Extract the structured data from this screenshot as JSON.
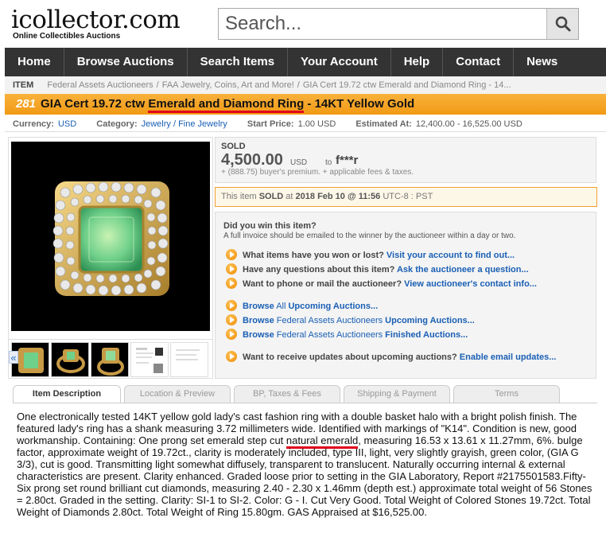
{
  "header": {
    "logo_text": "icollector.com",
    "logo_tagline": "Online Collectibles Auctions",
    "search_placeholder": "Search..."
  },
  "nav": {
    "items": [
      "Home",
      "Browse Auctions",
      "Search Items",
      "Your Account",
      "Help",
      "Contact",
      "News"
    ]
  },
  "breadcrumb": {
    "label": "ITEM",
    "items": [
      "Federal Assets Auctioneers",
      "FAA Jewelry, Coins, Art and More!",
      "GIA Cert 19.72 ctw Emerald and Diamond Ring - 14..."
    ]
  },
  "lot": {
    "number": "281",
    "title_pre": "GIA Cert 19.72 ctw ",
    "title_highlight": "Emerald and Diamond Ring",
    "title_post": " - 14KT Yellow Gold"
  },
  "info": {
    "currency_label": "Currency:",
    "currency_value": "USD",
    "category_label": "Category:",
    "category_value": "Jewelry / Fine Jewelry",
    "start_label": "Start Price:",
    "start_value": "1.00 USD",
    "est_label": "Estimated At:",
    "est_value": "12,400.00 - 16,525.00 USD"
  },
  "sold": {
    "label": "SOLD",
    "amount": "4,500.00",
    "currency": "USD",
    "to": "to",
    "buyer": "f***r",
    "fees": "+ (888.75) buyer's premium. + applicable fees & taxes."
  },
  "sold_note": {
    "pre": "This item ",
    "sold": "SOLD",
    "at": " at ",
    "date": "2018 Feb 10 @ 11:56",
    "tz": " UTC-8 : PST"
  },
  "win": {
    "question": "Did you win this item?",
    "answer": "A full invoice should be emailed to the winner by the auctioneer within a day or two."
  },
  "links": {
    "l1_text": "What items have you won or lost? ",
    "l1_link": "Visit your account to find out...",
    "l2_text": "Have any questions about this item? ",
    "l2_link": "Ask the auctioneer a question...",
    "l3_text": "Want to phone or mail the auctioneer? ",
    "l3_link": "View auctioneer's contact info...",
    "b1_a": "Browse",
    "b1_b": " All ",
    "b1_c": "Upcoming Auctions...",
    "b2_a": "Browse",
    "b2_b": " Federal Assets Auctioneers ",
    "b2_c": "Upcoming Auctions...",
    "b3_a": "Browse",
    "b3_b": " Federal Assets Auctioneers ",
    "b3_c": "Finished Auctions...",
    "u_text": "Want to receive updates about upcoming auctions? ",
    "u_link": "Enable email updates..."
  },
  "tabs": [
    "Item Description",
    "Location & Preview",
    "BP, Taxes & Fees",
    "Shipping & Payment",
    "Terms"
  ],
  "description": {
    "pre": "One electronically tested 14KT yellow gold lady's cast fashion ring with a double basket halo with a bright polish finish. The featured lady's ring has a shank measuring 3.72 millimeters wide. Identified with markings of \"K14\". Condition is new, good workmanship. Containing: One prong set emerald step cut ",
    "highlight": "natural emerald",
    "post": ", measuring 16.53 x 13.61 x 11.27mm, 6%. bulge factor, approximate weight of 19.72ct., clarity is moderately included, type III, light, very slightly grayish, green color, (GIA G 3/3), cut is good. Transmitting light somewhat diffusely, transparent to translucent. Naturally occurring internal & external characteristics are present. Clarity enhanced. Graded loose prior to setting in the GIA Laboratory, Report #2175501583.Fifty-Six prong set round brilliant cut diamonds, measuring 2.40 - 2.30 x 1.46mm (depth est.) approximate total weight of 56 Stones = 2.80ct. Graded in the setting. Clarity: SI-1 to SI-2. Color: G - I. Cut Very Good. Total Weight of Colored Stones 19.72ct. Total Weight of Diamonds 2.80ct. Total Weight of Ring 15.80gm. GAS Appraised at $16,525.00."
  },
  "colors": {
    "accent_orange": "#f19a14",
    "nav_bg": "#333333",
    "link_blue": "#1a5fb4",
    "highlight_red": "#e0001a"
  }
}
